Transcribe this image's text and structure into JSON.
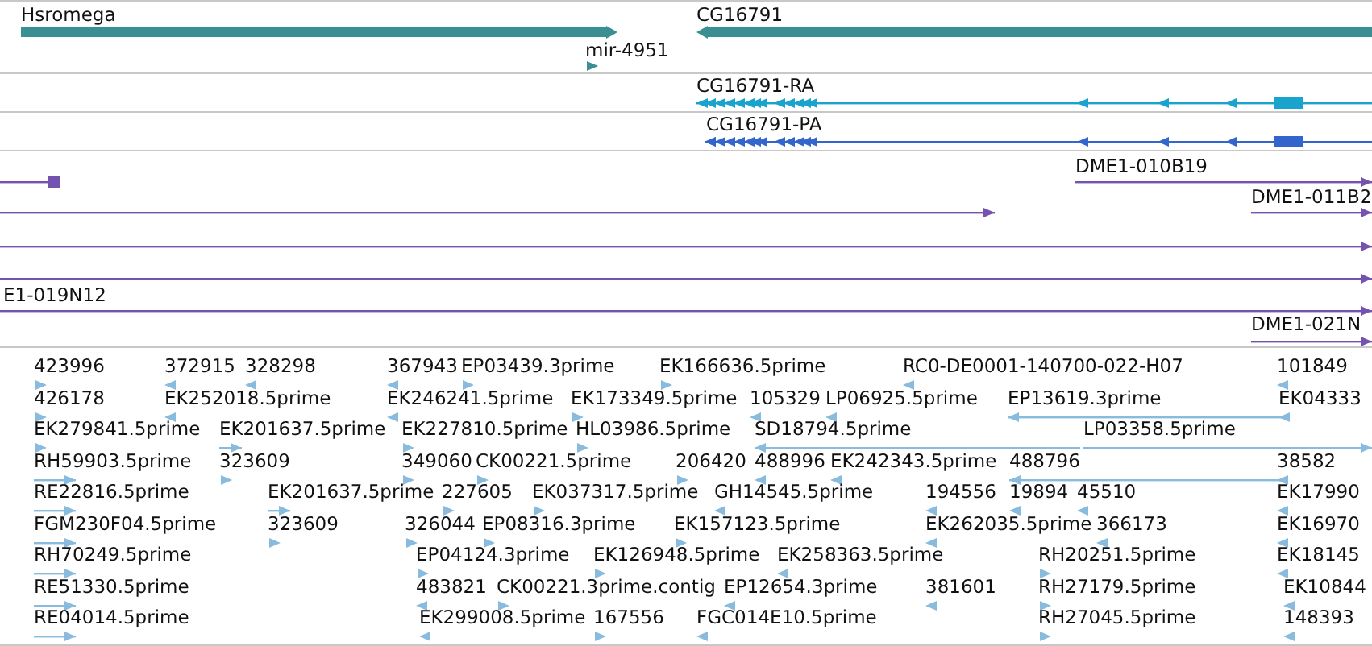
{
  "tracks": [
    {
      "kind": "genes",
      "features": [
        {
          "label": "Hsromega",
          "reverse": false
        },
        {
          "label": "CG16791",
          "reverse": true
        },
        {
          "label": "mir-4951",
          "reverse": false
        }
      ]
    },
    {
      "kind": "transcript",
      "features": [
        {
          "label": "CG16791-RA",
          "reverse": true
        }
      ]
    },
    {
      "kind": "protein",
      "features": [
        {
          "label": "CG16791-PA",
          "reverse": true
        }
      ]
    },
    {
      "kind": "clones",
      "features": [
        {
          "reverse": false
        },
        {
          "label": "DME1-010B19",
          "reverse": false
        },
        {
          "reverse": false
        },
        {
          "label": "DME1-011B2",
          "reverse": false
        },
        {
          "reverse": false
        },
        {
          "reverse": false
        },
        {
          "label": "E1-019N12",
          "reverse": false
        },
        {
          "label": "DME1-021N",
          "reverse": false
        }
      ]
    },
    {
      "kind": "ests",
      "lanes": [
        {
          "features": [
            {
              "label": "423996",
              "reverse": false
            },
            {
              "label": "372915",
              "reverse": true
            },
            {
              "label": "328298",
              "reverse": true
            },
            {
              "label": "367943",
              "reverse": true
            },
            {
              "label": "EP03439.3prime",
              "reverse": false
            },
            {
              "label": "EK166636.5prime",
              "reverse": false
            },
            {
              "label": "RC0-DE0001-140700-022-H07",
              "reverse": true
            },
            {
              "label": "101849",
              "reverse": true
            }
          ]
        },
        {
          "features": [
            {
              "label": "426178",
              "reverse": false
            },
            {
              "label": "EK252018.5prime",
              "reverse": true
            },
            {
              "label": "EK246241.5prime",
              "reverse": true
            },
            {
              "label": "EK173349.5prime",
              "reverse": false
            },
            {
              "label": "105329",
              "reverse": true
            },
            {
              "label": "LP06925.5prime",
              "reverse": true
            },
            {
              "label": "EP13619.3prime",
              "reverse": true
            },
            {
              "label": "EK04333",
              "reverse": true
            }
          ]
        },
        {
          "features": [
            {
              "label": "EK279841.5prime",
              "reverse": false
            },
            {
              "label": "EK201637.5prime",
              "reverse": false
            },
            {
              "label": "EK227810.5prime",
              "reverse": false
            },
            {
              "label": "HL03986.5prime",
              "reverse": false
            },
            {
              "label": "SD18794.5prime",
              "reverse": true
            },
            {
              "label": "LP03358.5prime",
              "reverse": false
            }
          ]
        },
        {
          "features": [
            {
              "label": "RH59903.5prime",
              "reverse": false
            },
            {
              "label": "323609",
              "reverse": false
            },
            {
              "label": "349060",
              "reverse": false
            },
            {
              "label": "CK00221.5prime",
              "reverse": false
            },
            {
              "label": "206420",
              "reverse": false
            },
            {
              "label": "488996",
              "reverse": true
            },
            {
              "label": "EK242343.5prime",
              "reverse": true
            },
            {
              "label": "488796",
              "reverse": true
            },
            {
              "label": "38582",
              "reverse": true
            }
          ]
        },
        {
          "features": [
            {
              "label": "RE22816.5prime",
              "reverse": false
            },
            {
              "label": "EK201637.5prime",
              "reverse": false
            },
            {
              "label": "227605",
              "reverse": false
            },
            {
              "label": "EK037317.5prime",
              "reverse": false
            },
            {
              "label": "GH14545.5prime",
              "reverse": true
            },
            {
              "label": "194556",
              "reverse": true
            },
            {
              "label": "19894",
              "reverse": true
            },
            {
              "label": "45510",
              "reverse": true
            },
            {
              "label": "EK17990",
              "reverse": true
            }
          ]
        },
        {
          "features": [
            {
              "label": "FGM230F04.5prime",
              "reverse": false
            },
            {
              "label": "323609",
              "reverse": false
            },
            {
              "label": "326044",
              "reverse": false
            },
            {
              "label": "EP08316.3prime",
              "reverse": false
            },
            {
              "label": "EK157123.5prime",
              "reverse": false
            },
            {
              "label": "EK262035.5prime",
              "reverse": true
            },
            {
              "label": "366173",
              "reverse": true
            },
            {
              "label": "EK16970",
              "reverse": true
            }
          ]
        },
        {
          "features": [
            {
              "label": "RH70249.5prime",
              "reverse": false
            },
            {
              "label": "EP04124.3prime",
              "reverse": false
            },
            {
              "label": "EK126948.5prime",
              "reverse": false
            },
            {
              "label": "EK258363.5prime",
              "reverse": true
            },
            {
              "label": "RH20251.5prime",
              "reverse": false
            },
            {
              "label": "EK18145",
              "reverse": true
            }
          ]
        },
        {
          "features": [
            {
              "label": "RE51330.5prime",
              "reverse": false
            },
            {
              "label": "483821",
              "reverse": true
            },
            {
              "label": "CK00221.3prime.contig",
              "reverse": false
            },
            {
              "label": "EP12654.3prime",
              "reverse": true
            },
            {
              "label": "381601",
              "reverse": true
            },
            {
              "label": "RH27179.5prime",
              "reverse": false
            },
            {
              "label": "EK10844",
              "reverse": true
            }
          ]
        },
        {
          "features": [
            {
              "label": "RE04014.5prime",
              "reverse": false
            },
            {
              "label": "EK299008.5prime",
              "reverse": true
            },
            {
              "label": "167556",
              "reverse": false
            },
            {
              "label": "FGC014E10.5prime",
              "reverse": true
            },
            {
              "label": "RH27045.5prime",
              "reverse": false
            },
            {
              "label": "148393",
              "reverse": true
            }
          ]
        }
      ]
    }
  ]
}
